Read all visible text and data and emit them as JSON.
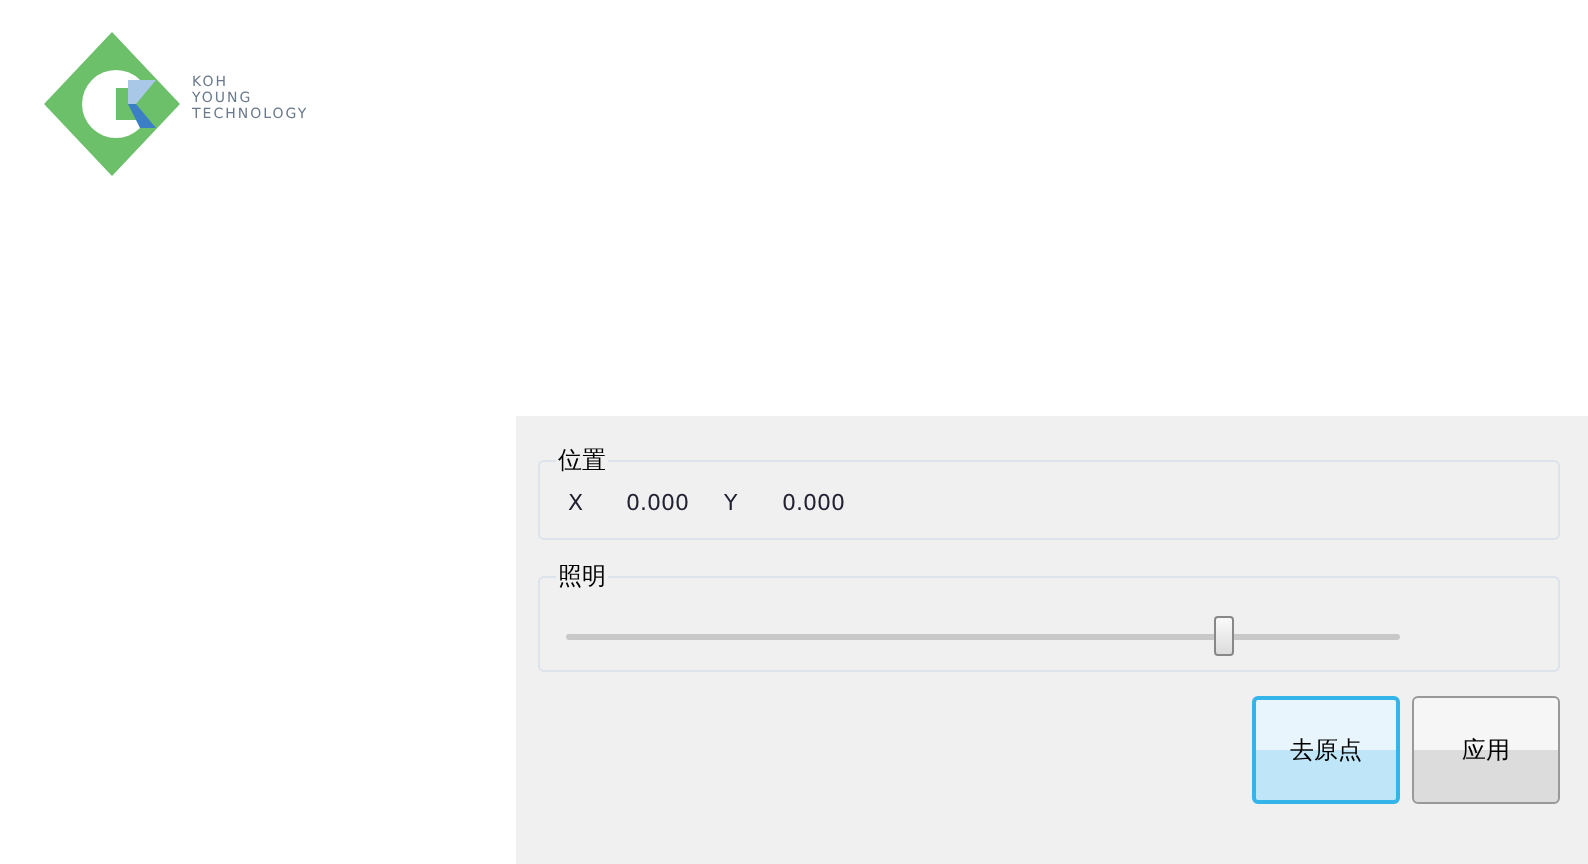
{
  "logo": {
    "lines": [
      "KOH",
      "YOUNG",
      "TECHNOLOGY"
    ]
  },
  "position_group": {
    "title": "位置",
    "fields": [
      {
        "label": "X",
        "value": "0.000"
      },
      {
        "label": "Y",
        "value": "0.000"
      }
    ]
  },
  "lighting_group": {
    "title": "照明",
    "slider": {
      "level": 0.79
    }
  },
  "buttons": [
    {
      "label": "去原点",
      "focused": true
    },
    {
      "label": "应用",
      "focused": false
    }
  ]
}
